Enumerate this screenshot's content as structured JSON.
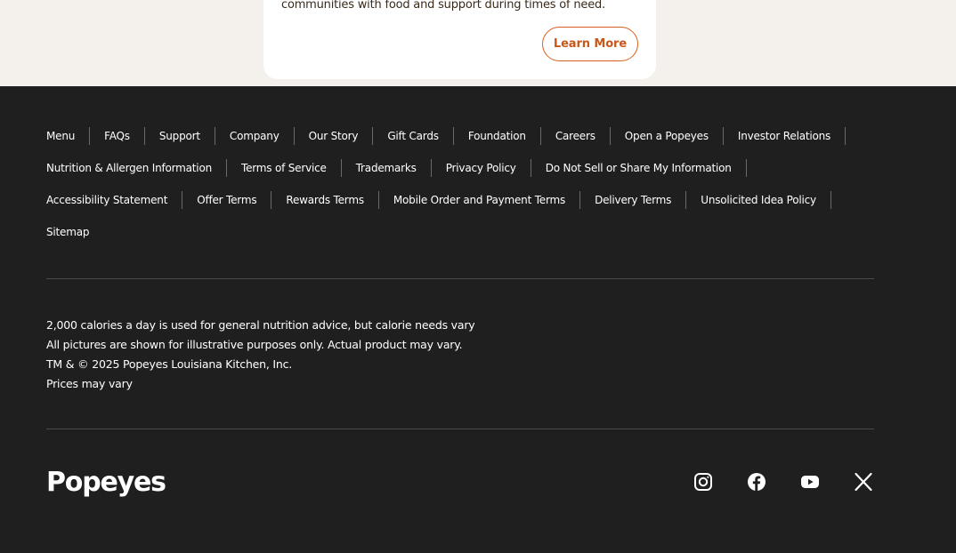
{
  "promo": {
    "text": "communities with food and support during times of need.",
    "button_label": "Learn More"
  },
  "footer": {
    "links_rows": [
      [
        "Menu",
        "FAQs",
        "Support",
        "Company",
        "Our Story",
        "Gift Cards",
        "Foundation",
        "Careers",
        "Open a Popeyes",
        "Investor Relations"
      ],
      [
        "Nutrition & Allergen Information",
        "Terms of Service",
        "Trademarks",
        "Privacy Policy",
        "Do Not Sell or Share My Information"
      ],
      [
        "Accessibility Statement",
        "Offer Terms",
        "Rewards Terms",
        "Mobile Order and Payment Terms",
        "Delivery Terms",
        "Unsolicited Idea Policy"
      ],
      [
        "Sitemap"
      ]
    ],
    "disclaimers": [
      "2,000 calories a day is used for general nutrition advice, but calorie needs vary",
      "All pictures are shown for illustrative purposes only. Actual product may vary.",
      "TM & © 2025 Popeyes Louisiana Kitchen, Inc.",
      "Prices may vary"
    ],
    "logo_text": "Popeyes",
    "social": [
      "instagram-icon",
      "facebook-icon",
      "youtube-icon",
      "x-icon"
    ]
  },
  "colors": {
    "footer_bg": "#1f1f1f",
    "top_bg": "#f4f0ec",
    "accent": "#d85f1f"
  }
}
